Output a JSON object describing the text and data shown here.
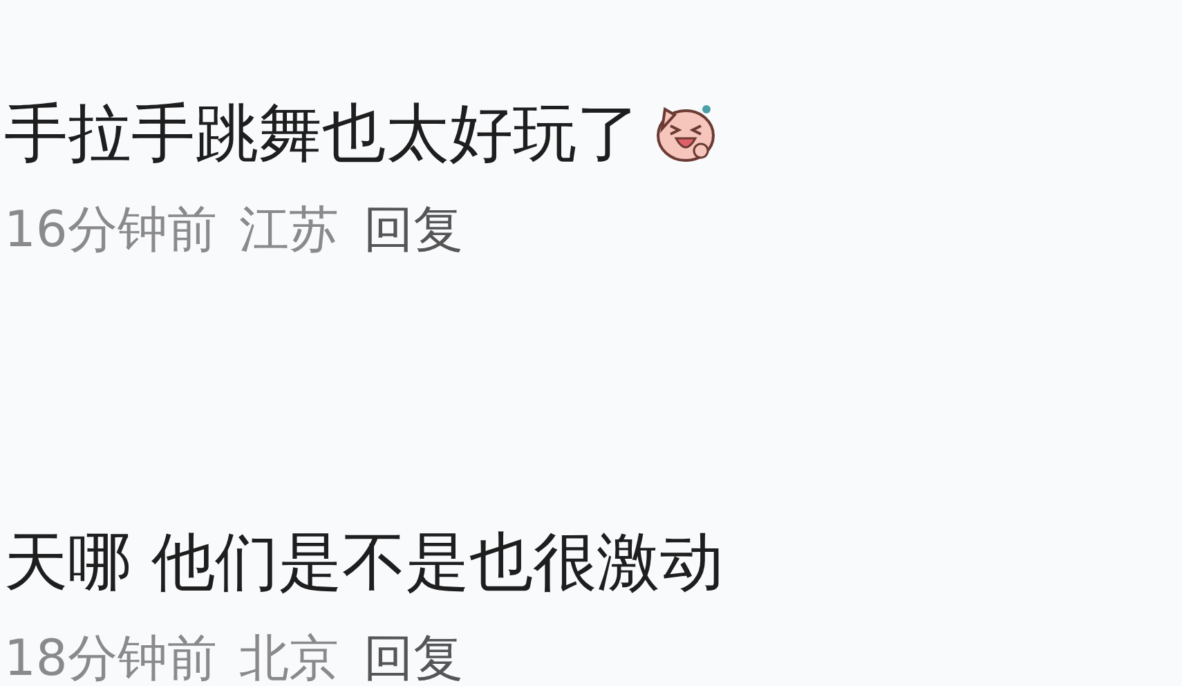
{
  "comments": [
    {
      "text": "手拉手跳舞也太好玩了",
      "emoji": true,
      "time": "16分钟前",
      "location": "江苏",
      "reply": "回复"
    },
    {
      "text": "天哪 他们是不是也很激动",
      "emoji": false,
      "time": "18分钟前",
      "location": "北京",
      "reply": "回复"
    }
  ]
}
